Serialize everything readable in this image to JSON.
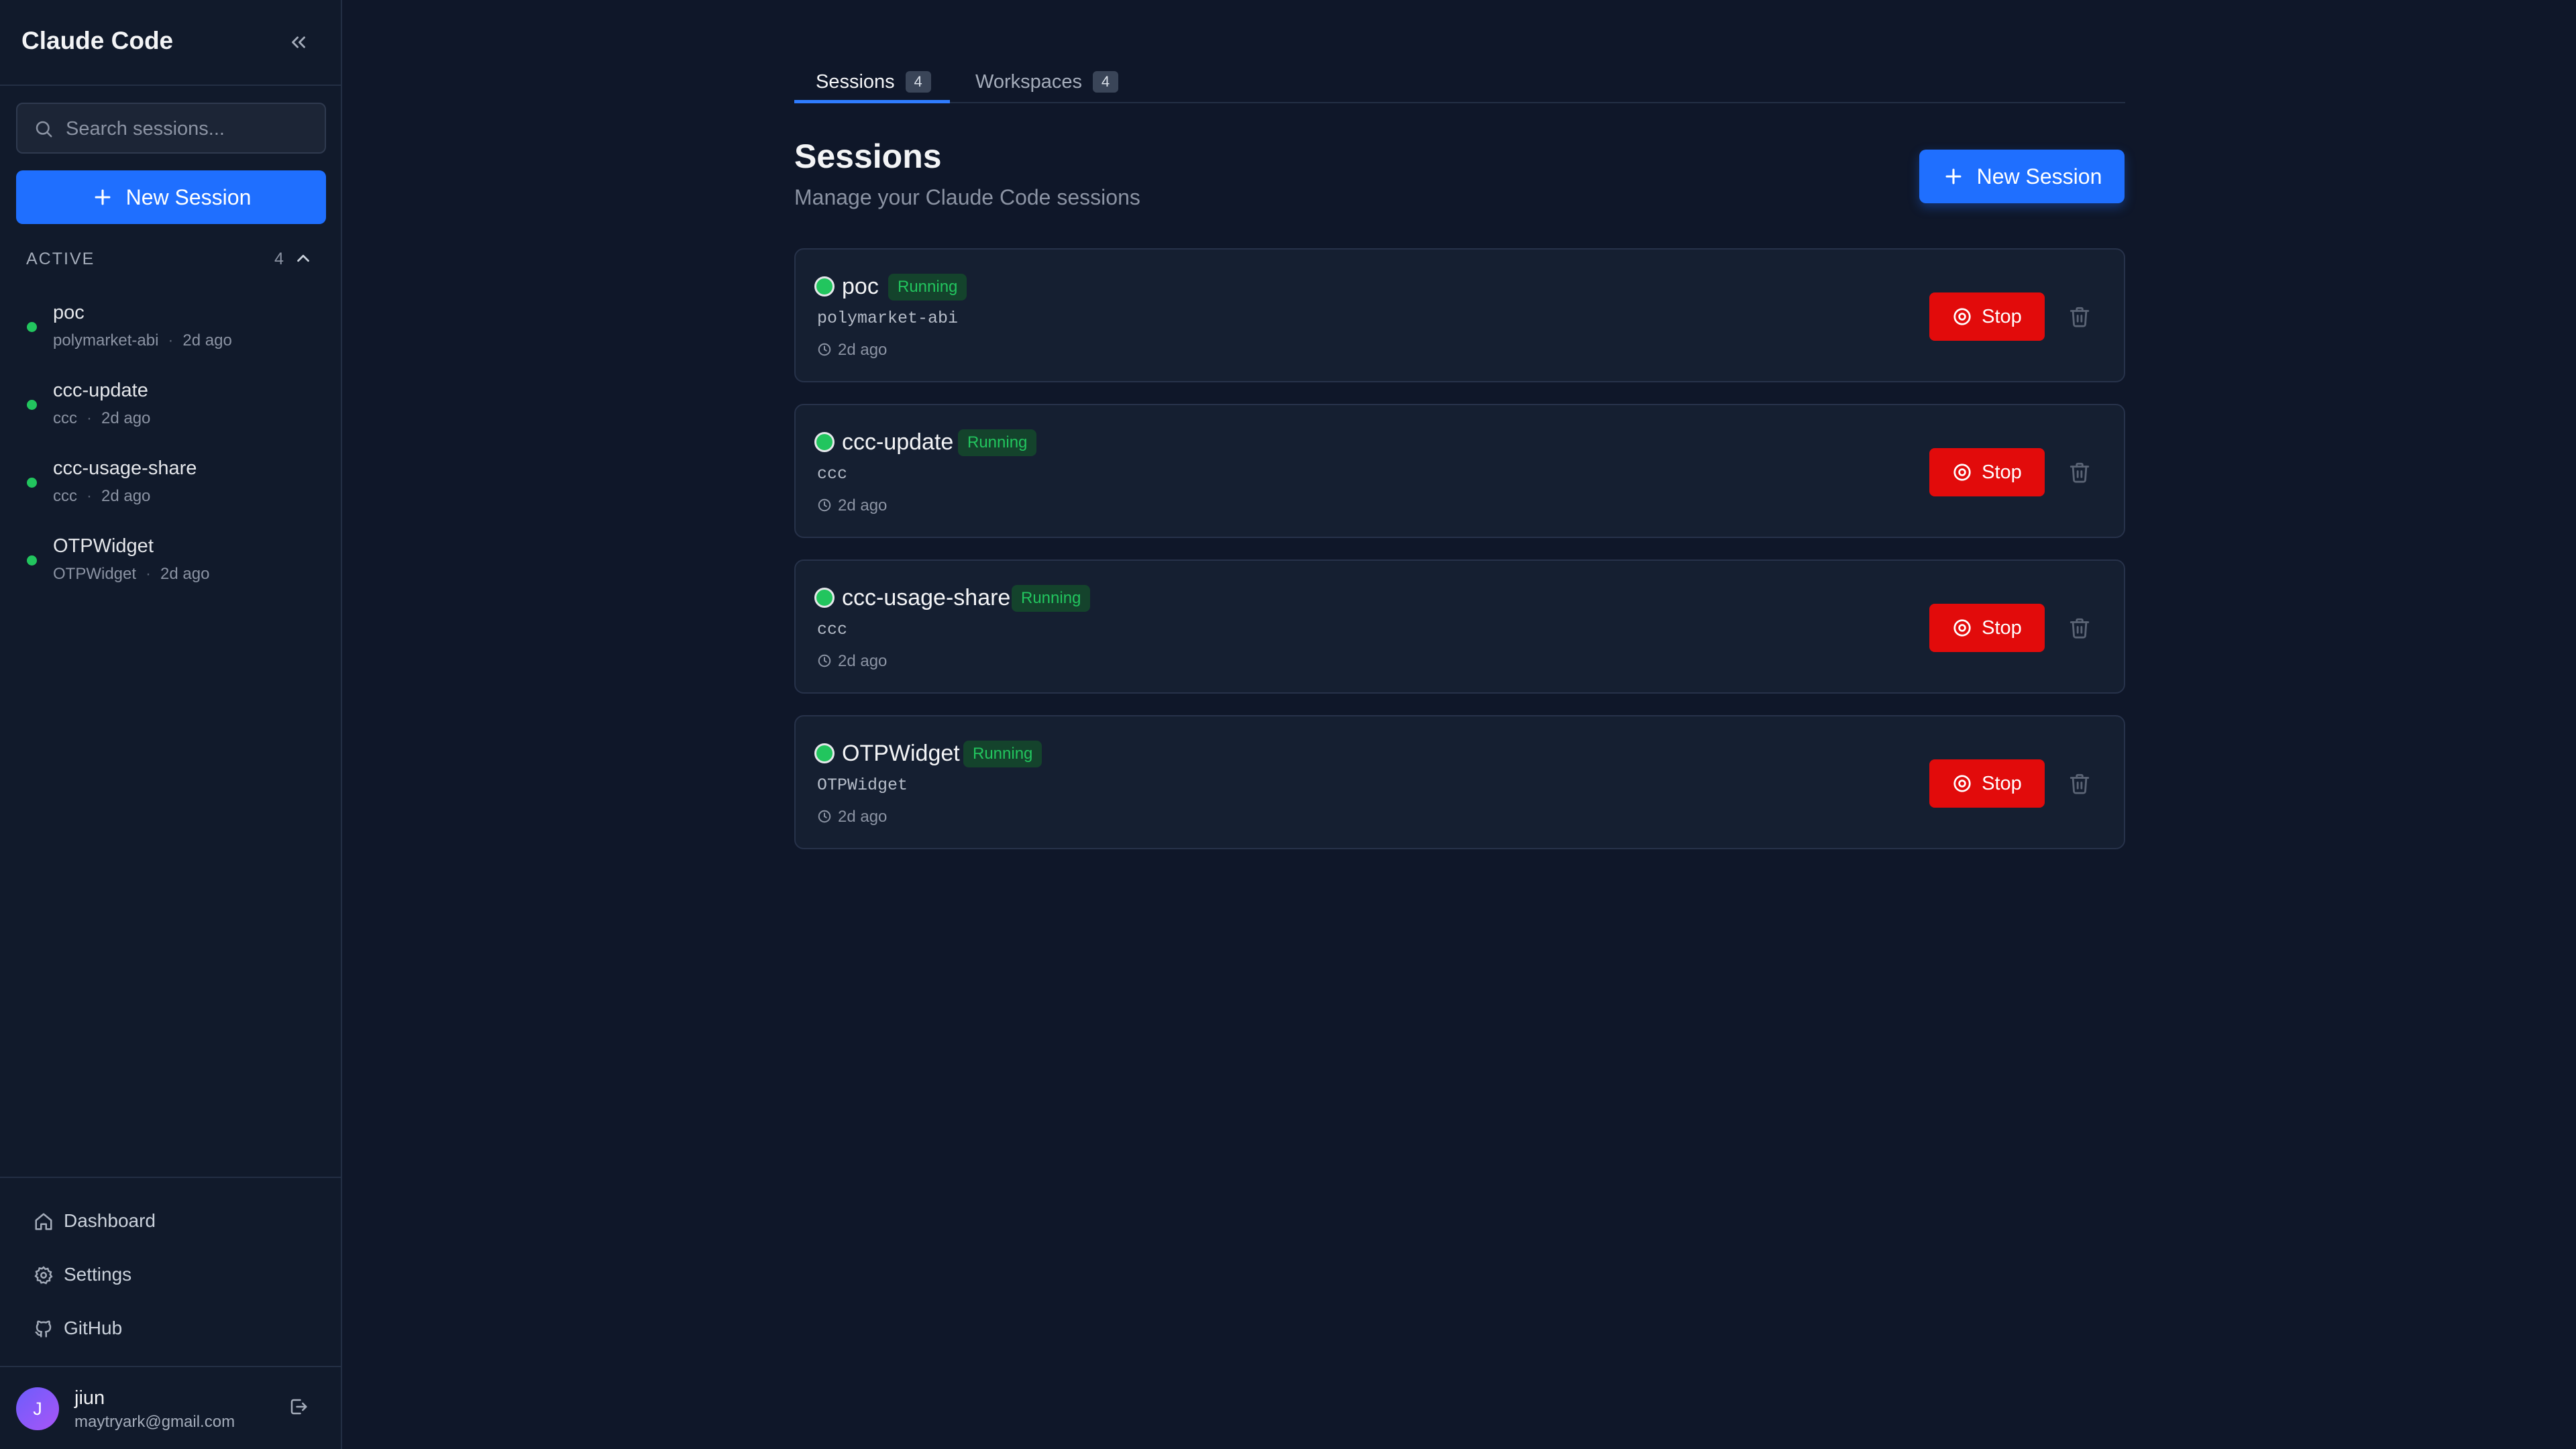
{
  "app": {
    "title": "Claude Code"
  },
  "sidebar": {
    "search_placeholder": "Search sessions...",
    "new_session_label": "New Session",
    "section": {
      "label": "ACTIVE",
      "count": "4"
    },
    "items": [
      {
        "name": "poc",
        "workspace": "polymarket-abi",
        "time": "2d ago",
        "status_color": "#22c55e"
      },
      {
        "name": "ccc-update",
        "workspace": "ccc",
        "time": "2d ago",
        "status_color": "#22c55e"
      },
      {
        "name": "ccc-usage-share",
        "workspace": "ccc",
        "time": "2d ago",
        "status_color": "#22c55e"
      },
      {
        "name": "OTPWidget",
        "workspace": "OTPWidget",
        "time": "2d ago",
        "status_color": "#22c55e"
      }
    ],
    "nav": [
      {
        "label": "Dashboard",
        "icon": "home-icon"
      },
      {
        "label": "Settings",
        "icon": "gear-icon"
      },
      {
        "label": "GitHub",
        "icon": "github-icon"
      }
    ],
    "user": {
      "initial": "J",
      "name": "jiun",
      "email": "maytryark@gmail.com"
    }
  },
  "main": {
    "tabs": [
      {
        "label": "Sessions",
        "count": "4",
        "active": true
      },
      {
        "label": "Workspaces",
        "count": "4",
        "active": false
      }
    ],
    "title": "Sessions",
    "subtitle": "Manage your Claude Code sessions",
    "new_session_label": "New Session",
    "sessions": [
      {
        "name": "poc",
        "status": "Running",
        "path": "polymarket-abi",
        "time": "2d ago",
        "stop_label": "Stop"
      },
      {
        "name": "ccc-update",
        "status": "Running",
        "path": "ccc",
        "time": "2d ago",
        "stop_label": "Stop"
      },
      {
        "name": "ccc-usage-share",
        "status": "Running",
        "path": "ccc",
        "time": "2d ago",
        "stop_label": "Stop"
      },
      {
        "name": "OTPWidget",
        "status": "Running",
        "path": "OTPWidget",
        "time": "2d ago",
        "stop_label": "Stop"
      }
    ]
  },
  "colors": {
    "accent": "#1f6fff",
    "danger": "#e20b0b",
    "running": "#22c55e",
    "background": "#0f1729",
    "sidebar": "#111a2b"
  }
}
